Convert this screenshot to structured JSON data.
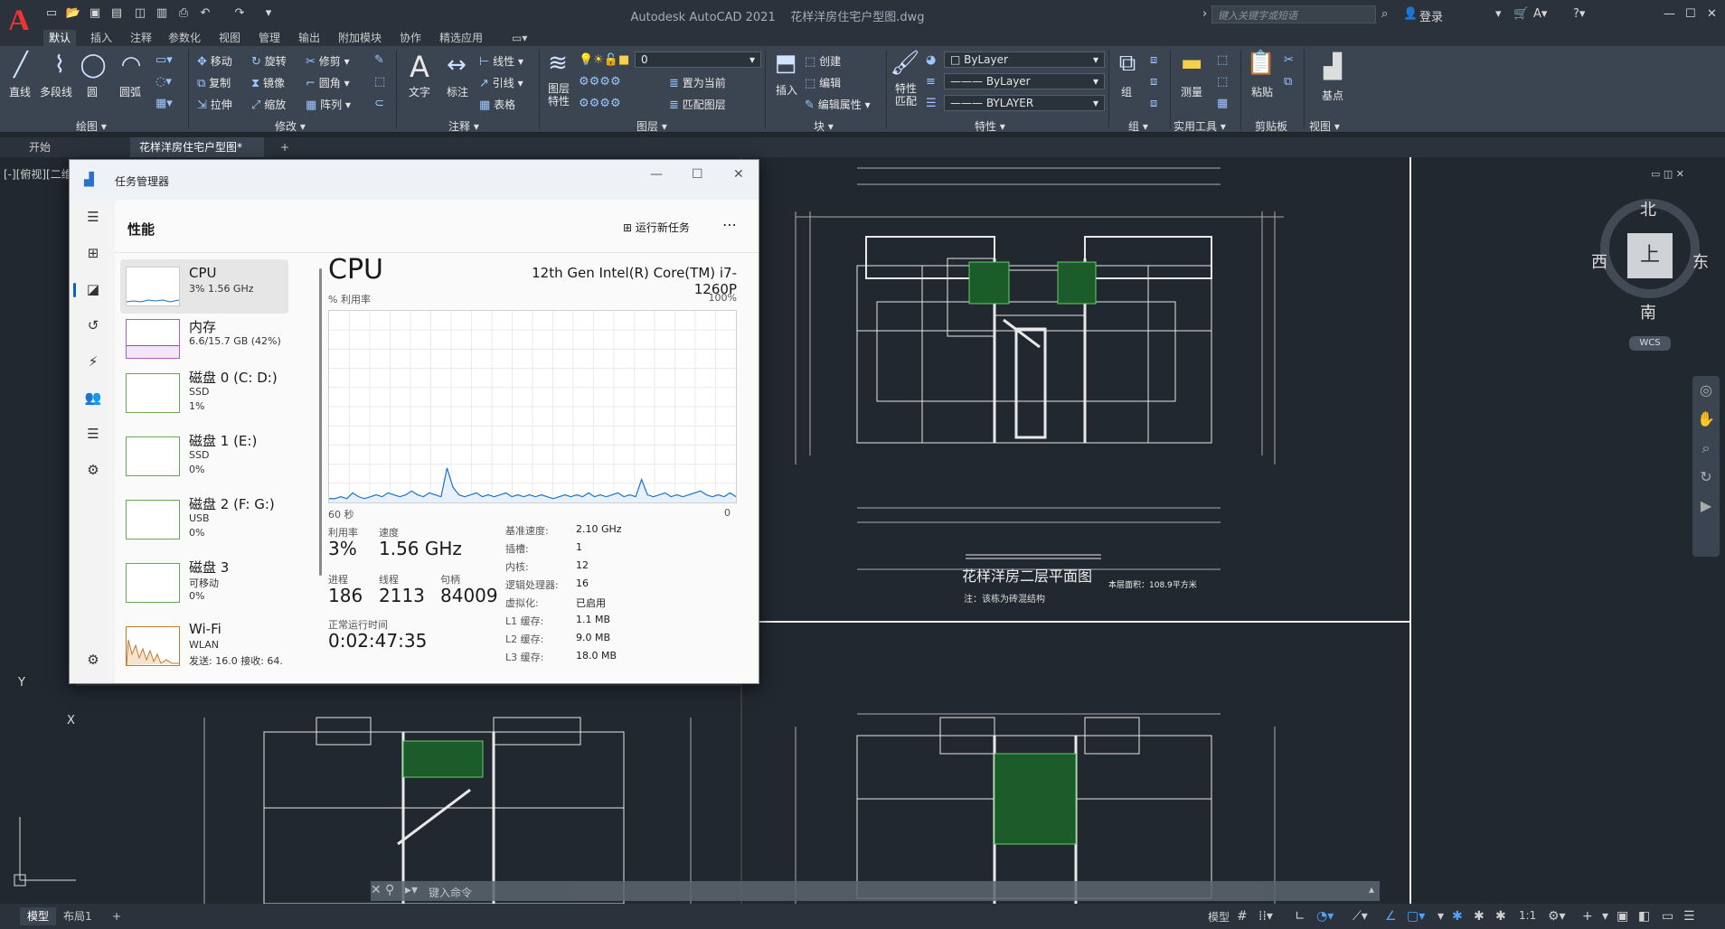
{
  "app": {
    "title": "Autodesk AutoCAD 2021",
    "file": "花样洋房住宅户型图.dwg",
    "search_placeholder": "键入关键字或短语",
    "login": "登录"
  },
  "ribbon_tabs": [
    "默认",
    "插入",
    "注释",
    "参数化",
    "视图",
    "管理",
    "输出",
    "附加模块",
    "协作",
    "精选应用"
  ],
  "ribbon": {
    "draw": {
      "line": "直线",
      "polyline": "多段线",
      "circle": "圆",
      "arc": "圆弧",
      "panel": "绘图 ▾"
    },
    "modify": {
      "move": "移动",
      "rotate": "旋转",
      "trim": "修剪",
      "copy": "复制",
      "mirror": "镜像",
      "fillet": "圆角",
      "stretch": "拉伸",
      "scale": "缩放",
      "array": "阵列",
      "panel": "修改 ▾"
    },
    "annotation": {
      "text": "文字",
      "dimension": "标注",
      "linear": "线性",
      "leader": "引线",
      "table": "表格",
      "panel": "注释 ▾"
    },
    "layers": {
      "layer_props": "图层特性",
      "layer_value": "0",
      "set_current": "置为当前",
      "match_layer": "匹配图层",
      "panel": "图层 ▾"
    },
    "block": {
      "insert": "插入",
      "create": "创建",
      "edit": "编辑",
      "edit_attr": "编辑属性",
      "panel": "块 ▾"
    },
    "properties": {
      "match": "特性匹配",
      "color": "ByLayer",
      "linetype": "ByLayer",
      "lineweight": "BYLAYER",
      "panel": "特性 ▾"
    },
    "groups": {
      "group": "组",
      "panel": "组 ▾"
    },
    "utilities": {
      "measure": "测量",
      "panel": "实用工具 ▾"
    },
    "clipboard": {
      "paste": "粘贴",
      "panel": "剪贴板"
    },
    "view": {
      "base": "基点",
      "panel": "视图 ▾"
    }
  },
  "doc_tabs": [
    "开始",
    "花样洋房住宅户型图*"
  ],
  "viewport_label": "[-][俯视][二维",
  "drawing": {
    "plan_title": "花样洋房二层平面图",
    "plan_note": "注：该栋为砖混结构",
    "area_note": "本层面积：108.9平方米"
  },
  "compass": {
    "north": "北",
    "south": "南",
    "east": "东",
    "west": "西",
    "top": "上",
    "wcs": "WCS"
  },
  "taskmgr": {
    "title": "任务管理器",
    "section": "性能",
    "run_task": "运行新任务",
    "items": [
      {
        "name": "CPU",
        "sub": "3% 1.56 GHz",
        "sub2": ""
      },
      {
        "name": "内存",
        "sub": "6.6/15.7 GB (42%)",
        "sub2": ""
      },
      {
        "name": "磁盘 0 (C: D:)",
        "sub": "SSD",
        "sub2": "1%"
      },
      {
        "name": "磁盘 1 (E:)",
        "sub": "SSD",
        "sub2": "0%"
      },
      {
        "name": "磁盘 2 (F: G:)",
        "sub": "USB",
        "sub2": "0%"
      },
      {
        "name": "磁盘 3",
        "sub": "可移动",
        "sub2": "0%"
      },
      {
        "name": "Wi-Fi",
        "sub": "WLAN",
        "sub2": "发送: 16.0  接收: 64."
      }
    ],
    "cpu_title": "CPU",
    "cpu_model": "12th Gen Intel(R) Core(TM) i7-1260P",
    "util_label": "% 利用率",
    "util_max": "100%",
    "time_left": "60 秒",
    "time_right": "0",
    "stats": {
      "util_label": "利用率",
      "util": "3%",
      "speed_label": "速度",
      "speed": "1.56 GHz",
      "proc_label": "进程",
      "proc": "186",
      "thread_label": "线程",
      "thread": "2113",
      "handle_label": "句柄",
      "handle": "84009",
      "uptime_label": "正常运行时间",
      "uptime": "0:02:47:35"
    },
    "specs": [
      [
        "基准速度:",
        "2.10 GHz"
      ],
      [
        "插槽:",
        "1"
      ],
      [
        "内核:",
        "12"
      ],
      [
        "逻辑处理器:",
        "16"
      ],
      [
        "虚拟化:",
        "已启用"
      ],
      [
        "L1 缓存:",
        "1.1 MB"
      ],
      [
        "L2 缓存:",
        "9.0 MB"
      ],
      [
        "L3 缓存:",
        "18.0 MB"
      ]
    ],
    "cpu_history": [
      2,
      2,
      3,
      2,
      5,
      3,
      2,
      3,
      4,
      3,
      5,
      4,
      3,
      4,
      6,
      4,
      3,
      5,
      4,
      3,
      18,
      8,
      4,
      3,
      4,
      5,
      3,
      4,
      3,
      4,
      5,
      3,
      4,
      3,
      4,
      3,
      4,
      3,
      2,
      3,
      4,
      3,
      4,
      3,
      5,
      3,
      4,
      3,
      4,
      5,
      3,
      4,
      3,
      12,
      4,
      3,
      4,
      5,
      3,
      4,
      3,
      4,
      5,
      6,
      4,
      3,
      4,
      3,
      5,
      3
    ]
  },
  "command": {
    "placeholder": "键入命令"
  },
  "statusbar": {
    "model": "模型",
    "layout": "布局1",
    "scale": "1:1"
  }
}
